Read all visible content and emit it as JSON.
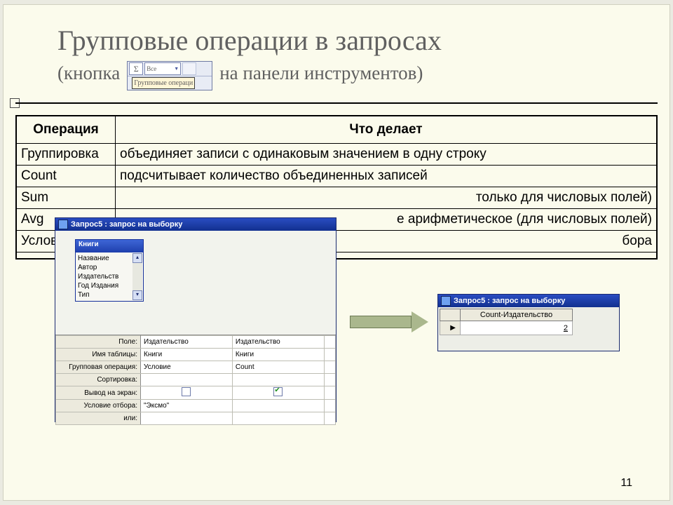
{
  "title": {
    "line1": "Групповые операции в запросах",
    "prefix": "(кнопка",
    "suffix": "на панели инструментов)"
  },
  "toolbar_shot": {
    "sigma": "Σ",
    "combo_value": "Все",
    "tooltip": "Групповые операци"
  },
  "table": {
    "headers": {
      "op": "Операция",
      "desc": "Что делает"
    },
    "rows": [
      {
        "op": "Группировка",
        "desc": "объединяет записи с одинаковым значением в одну строку"
      },
      {
        "op": "Count",
        "desc": "подсчитывает количество объединенных записей"
      },
      {
        "op": "Sum",
        "desc": "только для числовых полей)"
      },
      {
        "op": "Avg",
        "desc": "е арифметическое  (для числовых полей)"
      },
      {
        "op": "Услов",
        "desc": "бора"
      }
    ]
  },
  "query_window": {
    "title": "Запрос5 : запрос на выборку",
    "field_list": {
      "title": "Книги",
      "items": [
        "Название",
        "Автор",
        "Издательств",
        "Год Издания",
        "Тип"
      ]
    },
    "design_rows": {
      "field": {
        "label": "Поле:",
        "c1": "Издательство",
        "c2": "Издательство"
      },
      "table": {
        "label": "Имя таблицы:",
        "c1": "Книги",
        "c2": "Книги"
      },
      "total": {
        "label": "Групповая операция:",
        "c1": "Условие",
        "c2": "Count"
      },
      "sort": {
        "label": "Сортировка:",
        "c1": "",
        "c2": ""
      },
      "show": {
        "label": "Вывод на экран:",
        "c1_checked": false,
        "c2_checked": true
      },
      "criteria": {
        "label": "Условие отбора:",
        "c1": "\"Эксмо\"",
        "c2": ""
      },
      "or": {
        "label": "или:",
        "c1": "",
        "c2": ""
      }
    }
  },
  "result_window": {
    "title": "Запрос5 : запрос на выборку",
    "column": "Count-Издательство",
    "value": "2"
  },
  "page_number": "11"
}
